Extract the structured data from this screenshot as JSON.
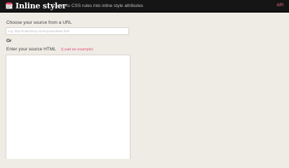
{
  "header": {
    "brand": "Inline styler",
    "tagline": "Converts CSS rules into inline style attributes",
    "right_link": "API",
    "logo_icon": "newspaper-logo-icon"
  },
  "form": {
    "url_label": "Choose your source from a URL",
    "url_placeholder": "e.g. http://mailchimp.com/mynewsletter.html",
    "url_value": "",
    "or_label": "Or",
    "html_label": "Enter your source HTML",
    "example_link": "(Load an example)",
    "html_value": ""
  },
  "colors": {
    "topbar": "#151515",
    "page_background": "#efece6",
    "accent_link": "#e5527a"
  }
}
